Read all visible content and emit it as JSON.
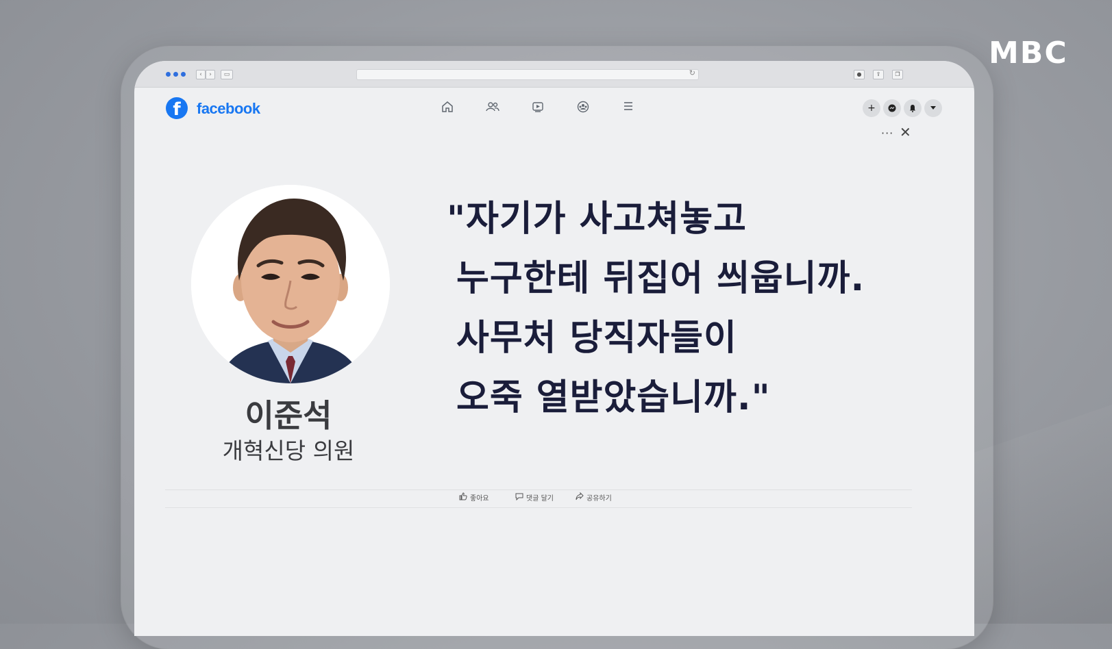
{
  "brand": {
    "broadcaster_logo": "MBC"
  },
  "browser": {
    "back_icon": "chevron-left-icon",
    "forward_icon": "chevron-right-icon",
    "reload_icon": "reload-icon"
  },
  "facebook": {
    "logo_letter": "f",
    "wordmark": "facebook",
    "brand_color": "#1877f2",
    "nav_icons": [
      "home-icon",
      "friends-icon",
      "video-icon",
      "groups-icon",
      "menu-icon"
    ],
    "right_buttons": [
      "plus-icon",
      "messenger-icon",
      "bell-icon",
      "caret-down-icon"
    ]
  },
  "post": {
    "more_label": "···",
    "close_label": "✕",
    "person": {
      "name": "이준석",
      "title": "개혁신당 의원"
    },
    "quote_lines": [
      "\"자기가 사고쳐놓고",
      "누구한테 뒤집어 씌웁니까.",
      "사무처 당직자들이",
      "오죽 열받았습니까.\""
    ],
    "actions": {
      "like": "좋아요",
      "comment": "댓글 달기",
      "share": "공유하기"
    }
  },
  "colors": {
    "quote_text": "#1a1d3a",
    "background": "#979aa0",
    "screen": "#eff0f2"
  }
}
